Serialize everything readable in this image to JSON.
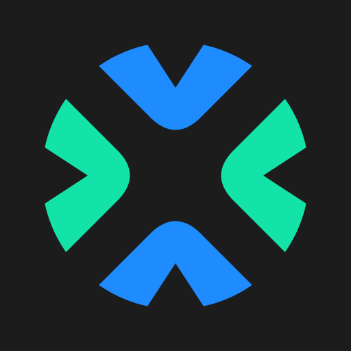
{
  "logo": {
    "icon": "four-chevron-mark-icon",
    "colors": {
      "background": "#1c1c1c",
      "blue": "#1e8bff",
      "green": "#13e3a8"
    }
  }
}
